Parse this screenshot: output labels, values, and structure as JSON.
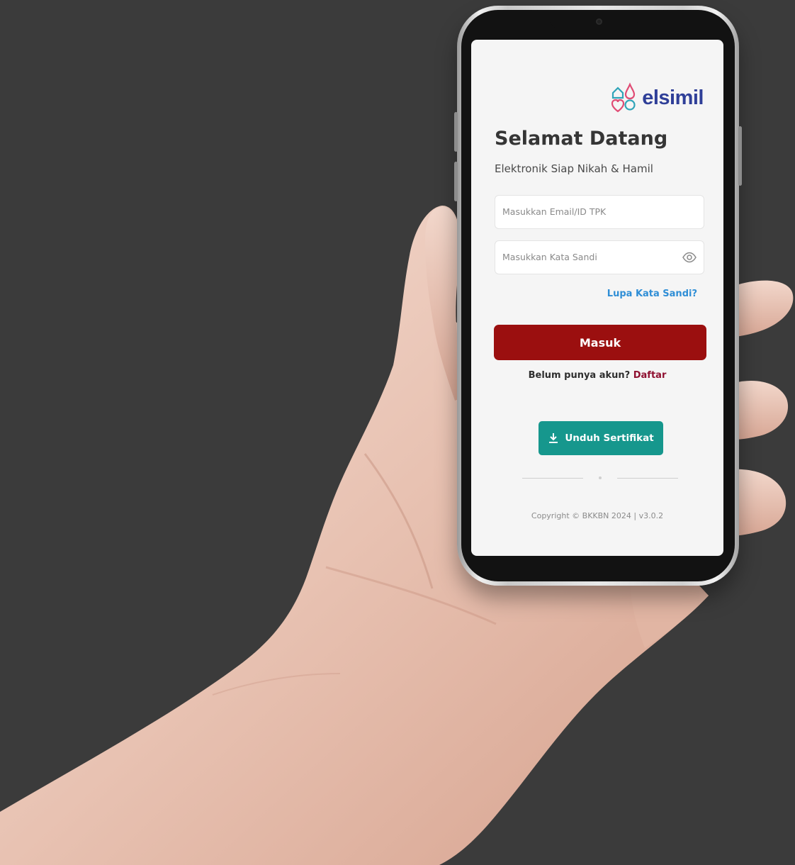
{
  "app": {
    "brand": "elsimil",
    "title": "Selamat Datang",
    "subtitle": "Elektronik Siap Nikah & Hamil"
  },
  "form": {
    "email_placeholder": "Masukkan Email/ID TPK",
    "password_placeholder": "Masukkan Kata Sandi",
    "forgot_password": "Lupa Kata Sandi?",
    "login_button": "Masuk",
    "register_prompt": "Belum punya akun?",
    "register_link": "Daftar",
    "certificate_button": "Unduh Sertifikat",
    "divider_text": "-"
  },
  "footer": {
    "copyright": "Copyright © BKKBN 2024 | v3.0.2"
  },
  "icons": {
    "logo": "elsimil-logo-icon",
    "eye": "eye-icon",
    "download": "download-icon"
  },
  "colors": {
    "background": "#3b3b3b",
    "primary": "#9b0f0f",
    "teal": "#16978d",
    "link": "#2f8ed6",
    "brand_blue": "#2f3f98"
  }
}
